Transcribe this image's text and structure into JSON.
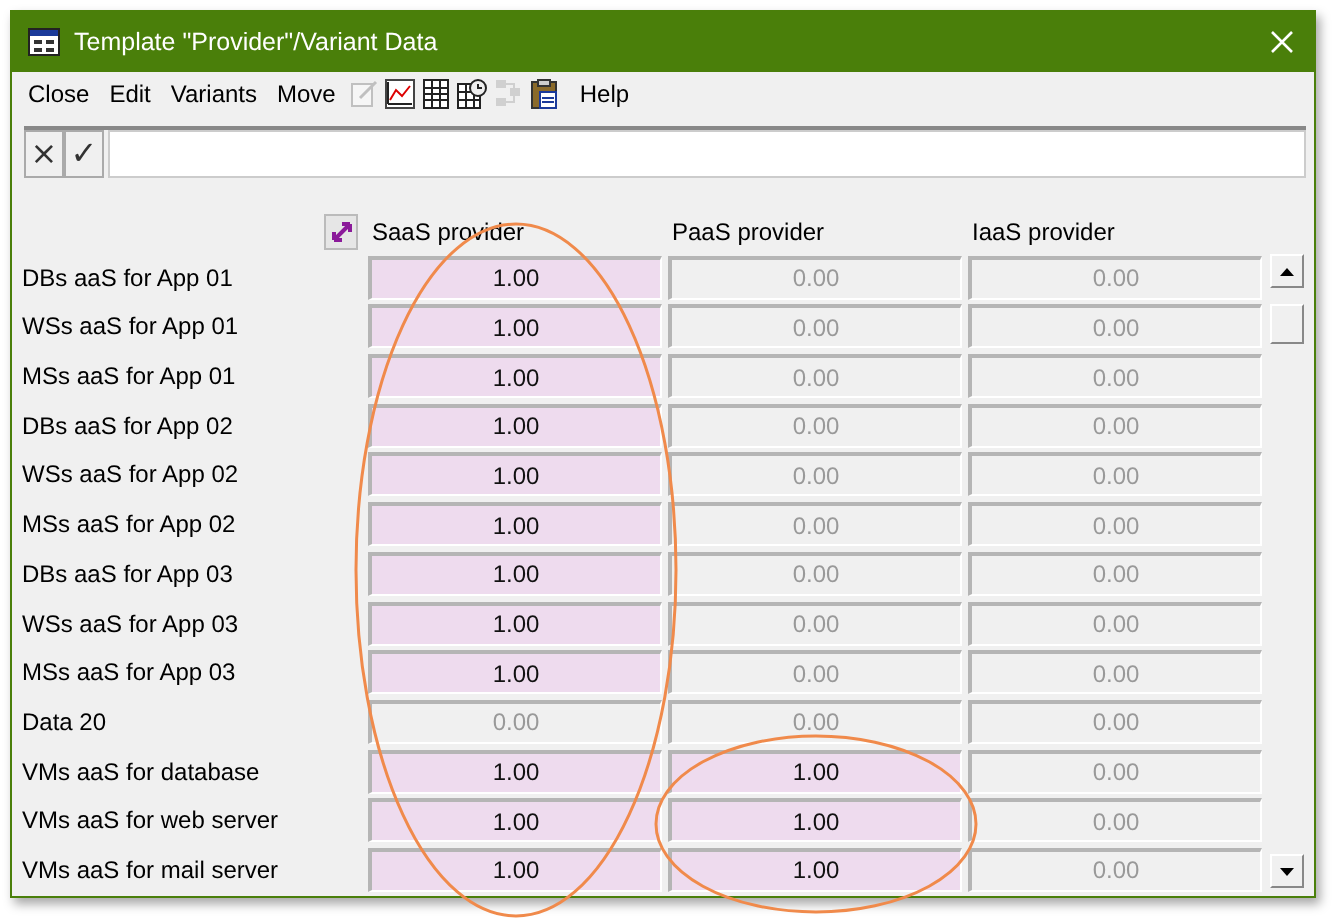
{
  "window": {
    "title": "Template \"Provider\"/Variant Data"
  },
  "menu": [
    {
      "kind": "item",
      "label": "Close"
    },
    {
      "kind": "item",
      "label": "Edit"
    },
    {
      "kind": "item",
      "label": "Variants"
    },
    {
      "kind": "item",
      "label": "Move"
    },
    {
      "kind": "tool",
      "disabled": true
    },
    {
      "kind": "tool",
      "disabled": false
    },
    {
      "kind": "tool",
      "disabled": false
    },
    {
      "kind": "tool",
      "disabled": false
    },
    {
      "kind": "tool",
      "disabled": true
    },
    {
      "kind": "tool",
      "disabled": false
    },
    {
      "kind": "item",
      "label": "Help"
    }
  ],
  "edit_bar": {
    "buttons": [
      "×",
      "✓"
    ]
  },
  "table": {
    "columns": [
      "SaaS provider",
      "PaaS provider",
      "IaaS provider"
    ],
    "rows": [
      {
        "label": "DBs aaS for App 01",
        "cells": [
          {
            "value": "1.00",
            "active": true
          },
          {
            "value": "0.00",
            "active": false
          },
          {
            "value": "0.00",
            "active": false
          }
        ]
      },
      {
        "label": "WSs aaS for App 01",
        "cells": [
          {
            "value": "1.00",
            "active": true
          },
          {
            "value": "0.00",
            "active": false
          },
          {
            "value": "0.00",
            "active": false
          }
        ]
      },
      {
        "label": "MSs aaS for App 01",
        "cells": [
          {
            "value": "1.00",
            "active": true
          },
          {
            "value": "0.00",
            "active": false
          },
          {
            "value": "0.00",
            "active": false
          }
        ]
      },
      {
        "label": "DBs aaS for App 02",
        "cells": [
          {
            "value": "1.00",
            "active": true
          },
          {
            "value": "0.00",
            "active": false
          },
          {
            "value": "0.00",
            "active": false
          }
        ]
      },
      {
        "label": "WSs aaS for App 02",
        "cells": [
          {
            "value": "1.00",
            "active": true
          },
          {
            "value": "0.00",
            "active": false
          },
          {
            "value": "0.00",
            "active": false
          }
        ]
      },
      {
        "label": "MSs aaS for App 02",
        "cells": [
          {
            "value": "1.00",
            "active": true
          },
          {
            "value": "0.00",
            "active": false
          },
          {
            "value": "0.00",
            "active": false
          }
        ]
      },
      {
        "label": "DBs aaS for App 03",
        "cells": [
          {
            "value": "1.00",
            "active": true
          },
          {
            "value": "0.00",
            "active": false
          },
          {
            "value": "0.00",
            "active": false
          }
        ]
      },
      {
        "label": "WSs aaS for App 03",
        "cells": [
          {
            "value": "1.00",
            "active": true
          },
          {
            "value": "0.00",
            "active": false
          },
          {
            "value": "0.00",
            "active": false
          }
        ]
      },
      {
        "label": "MSs aaS for App 03",
        "cells": [
          {
            "value": "1.00",
            "active": true
          },
          {
            "value": "0.00",
            "active": false
          },
          {
            "value": "0.00",
            "active": false
          }
        ]
      },
      {
        "label": "Data 20",
        "cells": [
          {
            "value": "0.00",
            "active": false
          },
          {
            "value": "0.00",
            "active": false
          },
          {
            "value": "0.00",
            "active": false
          }
        ]
      },
      {
        "label": "VMs aaS for database",
        "cells": [
          {
            "value": "1.00",
            "active": true
          },
          {
            "value": "1.00",
            "active": true
          },
          {
            "value": "0.00",
            "active": false
          }
        ]
      },
      {
        "label": "VMs aaS for web server",
        "cells": [
          {
            "value": "1.00",
            "active": true
          },
          {
            "value": "1.00",
            "active": true
          },
          {
            "value": "0.00",
            "active": false
          }
        ]
      },
      {
        "label": "VMs aaS for mail server",
        "cells": [
          {
            "value": "1.00",
            "active": true
          },
          {
            "value": "1.00",
            "active": true
          },
          {
            "value": "0.00",
            "active": false
          }
        ]
      }
    ]
  },
  "annotations": [
    {
      "kind": "ellipse"
    },
    {
      "kind": "ellipse"
    }
  ]
}
